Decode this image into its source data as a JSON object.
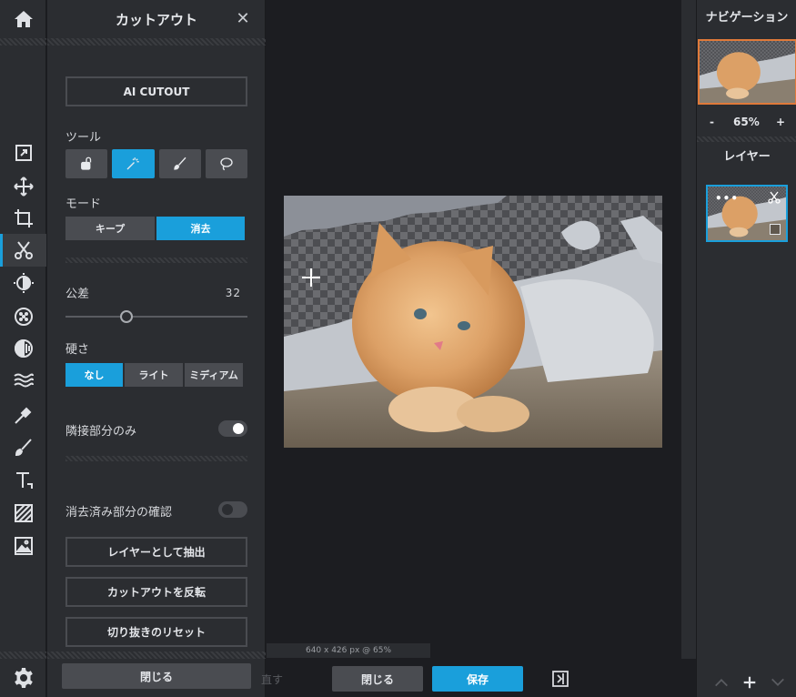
{
  "panel": {
    "title": "カットアウト",
    "close_glyph": "✕",
    "ai_cutout": "AI CUTOUT",
    "tools_label": "ツール",
    "mode_label": "モード",
    "mode_options": [
      "キープ",
      "消去"
    ],
    "mode_selected": "消去",
    "tolerance_label": "公差",
    "tolerance_value": "32",
    "hardness_label": "硬さ",
    "hardness_options": [
      "なし",
      "ライト",
      "ミディアム"
    ],
    "hardness_selected": "なし",
    "contiguous_label": "隣接部分のみ",
    "contiguous_on": true,
    "show_erased_label": "消去済み部分の確認",
    "show_erased_on": false,
    "extract_layer": "レイヤーとして抽出",
    "invert_cutout": "カットアウトを反転",
    "reset_cutout": "切り抜きのリセット",
    "close_button": "閉じる"
  },
  "canvas": {
    "status": "640 x 426 px @ 65%"
  },
  "bottom": {
    "undo": "直す",
    "close": "閉じる",
    "save": "保存"
  },
  "right": {
    "navigation_title": "ナビゲーション",
    "zoom_minus": "-",
    "zoom_value": "65%",
    "zoom_plus": "+",
    "layers_title": "レイヤー",
    "layer_more": "•••"
  },
  "colors": {
    "accent": "#1a9fdb",
    "panel_bg": "#2b2d31",
    "canvas_bg": "#1c1d21",
    "nav_border": "#e07a3a"
  }
}
